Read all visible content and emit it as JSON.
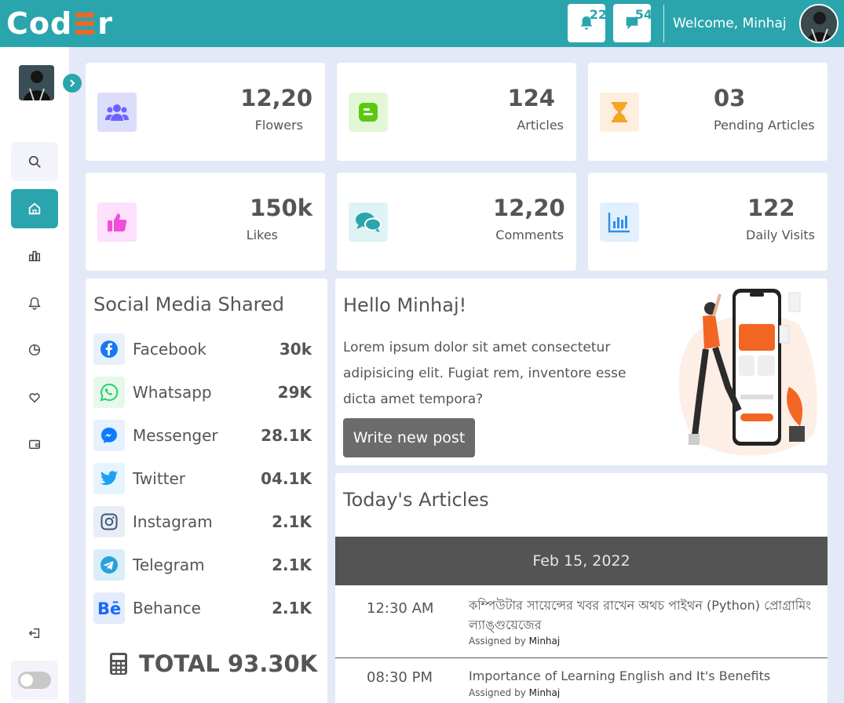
{
  "header": {
    "logo_left": "Cod",
    "logo_right": "r",
    "notifications_count": "22",
    "messages_count": "54",
    "welcome": "Welcome, Minhaj"
  },
  "stats": [
    {
      "value": "12,20",
      "label": "Flowers",
      "icon": "users-icon",
      "bg": "#dcdcfb",
      "color": "#6c63ff"
    },
    {
      "value": "124",
      "label": "Articles",
      "icon": "blogger-icon",
      "bg": "#e3f7d6",
      "color": "#58c90f"
    },
    {
      "value": "03",
      "label": "Pending Articles",
      "icon": "hourglass-icon",
      "bg": "#fdeede",
      "color": "#f5a623"
    },
    {
      "value": "150k",
      "label": "Likes",
      "icon": "thumbs-up-icon",
      "bg": "#fde0fb",
      "color": "#f04dd8"
    },
    {
      "value": "12,20",
      "label": "Comments",
      "icon": "comments-icon",
      "bg": "#dff3f4",
      "color": "#2ba5ad"
    },
    {
      "value": "122",
      "label": "Daily Visits",
      "icon": "bar-chart-icon",
      "bg": "#e2f0fd",
      "color": "#2f8fe6"
    }
  ],
  "social": {
    "title": "Social Media Shared",
    "items": [
      {
        "name": "Facebook",
        "value": "30k",
        "icon": "facebook-icon",
        "color": "#1877f2",
        "bg": "#e8f0fc"
      },
      {
        "name": "Whatsapp",
        "value": "29K",
        "icon": "whatsapp-icon",
        "color": "#25d366",
        "bg": "#e6f8ec"
      },
      {
        "name": "Messenger",
        "value": "28.1K",
        "icon": "messenger-icon",
        "color": "#0a7cff",
        "bg": "#e6f1fd"
      },
      {
        "name": "Twitter",
        "value": "04.1K",
        "icon": "twitter-icon",
        "color": "#1da1f2",
        "bg": "#e5f4fd"
      },
      {
        "name": "Instagram",
        "value": "2.1K",
        "icon": "instagram-icon",
        "color": "#3b5a80",
        "bg": "#e9eef4"
      },
      {
        "name": "Telegram",
        "value": "2.1K",
        "icon": "telegram-icon",
        "color": "#2aa1da",
        "bg": "#d9eef8"
      },
      {
        "name": "Behance",
        "value": "2.1K",
        "icon": "behance-icon",
        "color": "#1769ff",
        "bg": "#e3ecfd"
      }
    ],
    "total": "TOTAL 93.30K"
  },
  "hello": {
    "title": "Hello Minhaj!",
    "text": "Lorem ipsum dolor sit amet consectetur adipisicing elit. Fugiat rem, inventore esse dicta amet tempora?",
    "button": "Write new post"
  },
  "articles": {
    "title": "Today's Articles",
    "date": "Feb 15, 2022",
    "assigned_label": "Assigned by",
    "rows": [
      {
        "time": "12:30 AM",
        "title": "কম্পিউটার সায়েন্সের খবর রাখেন অথচ পাইথন (Python) প্রোগ্রামিং ল্যাঙ্গুয়েজের",
        "assigned": "Minhaj"
      },
      {
        "time": "08:30 PM",
        "title": "Importance of Learning English and It's Benefits",
        "assigned": "Minhaj"
      }
    ]
  }
}
